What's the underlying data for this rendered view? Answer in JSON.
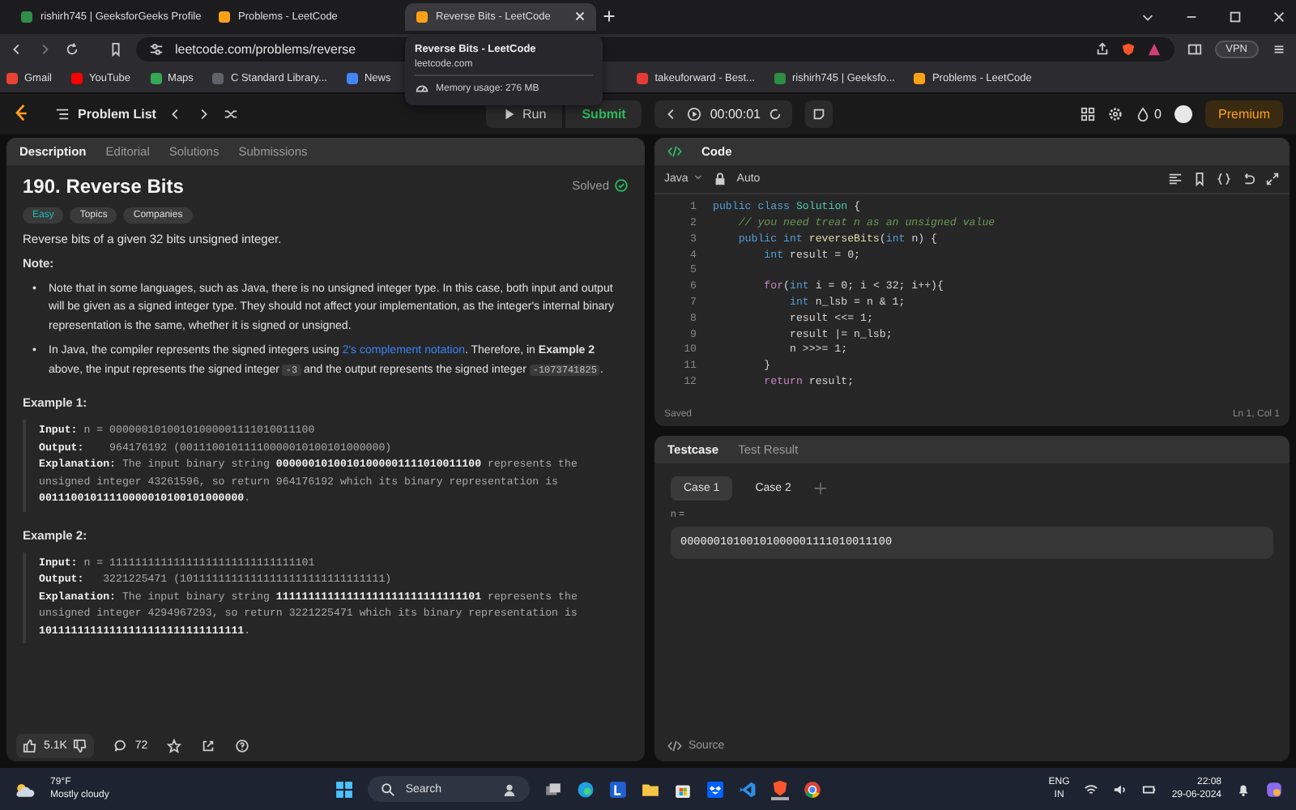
{
  "browser": {
    "tabs": [
      {
        "title": "rishirh745 | GeeksforGeeks Profile",
        "selected": false,
        "color": "#2f8d46"
      },
      {
        "title": "Problems - LeetCode",
        "selected": false,
        "color": "#ffa116"
      },
      {
        "title": "Reverse Bits - LeetCode",
        "selected": true,
        "color": "#ffa116"
      }
    ],
    "url": "leetcode.com/problems/reverse",
    "vpn": "VPN",
    "bookmarks": [
      {
        "label": "Gmail",
        "color": "#ea4335"
      },
      {
        "label": "YouTube",
        "color": "#ff0000"
      },
      {
        "label": "Maps",
        "color": "#34a853"
      },
      {
        "label": "C Standard Library...",
        "color": "#5f6368"
      },
      {
        "label": "News",
        "color": "#4285f4"
      },
      {
        "label": "takeuforward - Best...",
        "color": "#e53935"
      },
      {
        "label": "rishirh745 | Geeksfo...",
        "color": "#2f8d46"
      },
      {
        "label": "Problems - LeetCode",
        "color": "#ffa116"
      }
    ],
    "tooltip": {
      "title": "Reverse Bits - LeetCode",
      "domain": "leetcode.com",
      "memory": "Memory usage: 276 MB"
    }
  },
  "nav": {
    "problem_list": "Problem List",
    "run": "Run",
    "submit": "Submit",
    "timer": "00:00:01",
    "streak": "0",
    "premium": "Premium"
  },
  "description": {
    "tabs": [
      {
        "label": "Description",
        "selected": true
      },
      {
        "label": "Editorial",
        "selected": false
      },
      {
        "label": "Solutions",
        "selected": false
      },
      {
        "label": "Submissions",
        "selected": false
      }
    ],
    "title": "190. Reverse Bits",
    "status": "Solved",
    "difficulty": "Easy",
    "tags": [
      "Topics",
      "Companies"
    ],
    "intro": "Reverse bits of a given 32 bits unsigned integer.",
    "note_heading": "Note:",
    "bullets": [
      {
        "marker": "•",
        "segments": [
          {
            "kind": "text",
            "text": "Note that in some languages, such as Java, there is no unsigned integer type. In this case, both input and output will be given as a signed integer type. They should not affect your implementation, as the integer's internal binary representation is the same, whether it is signed or unsigned."
          }
        ]
      },
      {
        "marker": "•",
        "segments": [
          {
            "kind": "text",
            "text": "In Java, the compiler represents the signed integers using "
          },
          {
            "kind": "link",
            "text": "2's complement notation"
          },
          {
            "kind": "text",
            "text": ". Therefore, in "
          },
          {
            "kind": "bold",
            "text": "Example 2"
          },
          {
            "kind": "text",
            "text": " above, the input represents the signed integer "
          },
          {
            "kind": "code",
            "text": "-3"
          },
          {
            "kind": "text",
            "text": " and the output represents the signed integer "
          },
          {
            "kind": "code",
            "text": "-1073741825"
          },
          {
            "kind": "text",
            "text": "."
          }
        ]
      }
    ],
    "examples": [
      {
        "heading": "Example 1:",
        "lines": [
          "**Input:** n = 00000010100101000001111010011100",
          "**Output:**    964176192 (00111001011110000010100101000000)",
          "**Explanation:** The input binary string **00000010100101000001111010011100** represents the unsigned integer 43261596, so return 964176192 which its binary representation is **00111001011110000010100101000000**."
        ]
      },
      {
        "heading": "Example 2:",
        "lines": [
          "**Input:** n = 11111111111111111111111111111101",
          "**Output:**   3221225471 (10111111111111111111111111111111)",
          "**Explanation:** The input binary string **11111111111111111111111111111101** represents the unsigned integer 4294967293, so return 3221225471 which its binary representation is **10111111111111111111111111111111**."
        ]
      }
    ],
    "footer": {
      "likes": "5.1K",
      "comments": "72"
    }
  },
  "editor": {
    "title": "Code",
    "language": "Java",
    "mode": "Auto",
    "status_left": "Saved",
    "status_right": "Ln 1, Col 1",
    "lines": [
      {
        "number": "1",
        "segments": [
          {
            "kind": "kw",
            "text": "public class "
          },
          {
            "kind": "type",
            "text": "Solution"
          },
          {
            "kind": "plain",
            "text": " {"
          }
        ]
      },
      {
        "number": "2",
        "segments": [
          {
            "kind": "comment",
            "text": "    // you need treat n as an unsigned value"
          }
        ]
      },
      {
        "number": "3",
        "segments": [
          {
            "kind": "kw",
            "text": "    public int "
          },
          {
            "kind": "fn",
            "text": "reverseBits"
          },
          {
            "kind": "plain",
            "text": "("
          },
          {
            "kind": "kw",
            "text": "int"
          },
          {
            "kind": "plain",
            "text": " n) {"
          }
        ]
      },
      {
        "number": "4",
        "segments": [
          {
            "kind": "kw",
            "text": "        int"
          },
          {
            "kind": "plain",
            "text": " result = 0;"
          }
        ]
      },
      {
        "number": "5"
      },
      {
        "number": "6",
        "segments": [
          {
            "kind": "control",
            "text": "        for"
          },
          {
            "kind": "plain",
            "text": "("
          },
          {
            "kind": "kw",
            "text": "int"
          },
          {
            "kind": "plain",
            "text": " i = 0; i < 32; i++){"
          }
        ]
      },
      {
        "number": "7",
        "segments": [
          {
            "kind": "kw",
            "text": "            int"
          },
          {
            "kind": "plain",
            "text": " n_lsb = n & 1;"
          }
        ]
      },
      {
        "number": "8",
        "segments": [
          {
            "kind": "plain",
            "text": "            result <<= 1;"
          }
        ]
      },
      {
        "number": "9",
        "segments": [
          {
            "kind": "plain",
            "text": "            result |= n_lsb;"
          }
        ]
      },
      {
        "number": "10",
        "segments": [
          {
            "kind": "plain",
            "text": "            n >>>= 1;"
          }
        ]
      },
      {
        "number": "11",
        "segments": [
          {
            "kind": "plain",
            "text": "        }"
          }
        ]
      },
      {
        "number": "12",
        "segments": [
          {
            "kind": "control",
            "text": "        return"
          },
          {
            "kind": "plain",
            "text": " result;"
          }
        ]
      }
    ]
  },
  "testcase": {
    "tabs": [
      {
        "label": "Testcase",
        "selected": true
      },
      {
        "label": "Test Result",
        "selected": false
      }
    ],
    "cases": [
      {
        "label": "Case 1",
        "selected": true
      },
      {
        "label": "Case 2",
        "selected": false
      }
    ],
    "param": "n =",
    "value": "00000010100101000001111010011100",
    "source": "Source"
  },
  "taskbar": {
    "temperature": "79°F",
    "weather": "Mostly cloudy",
    "search": "Search",
    "lang": "ENG",
    "region": "IN",
    "time": "22:08",
    "date": "29-06-2024"
  }
}
